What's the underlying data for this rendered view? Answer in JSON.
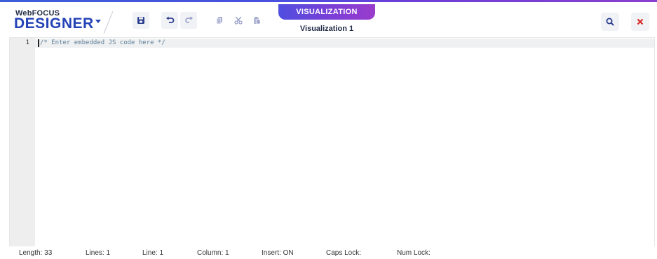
{
  "app": {
    "brand_small": "WebFOCUS",
    "brand_big": "DESIGNER"
  },
  "toolbar": {
    "icons": [
      "save-icon",
      "undo-icon",
      "redo-icon",
      "copy-icon",
      "cut-icon",
      "paste-icon"
    ]
  },
  "tab": {
    "label": "VISUALIZATION",
    "name": "Visualization 1"
  },
  "header_right": {
    "icons": [
      "search-icon",
      "close-icon"
    ]
  },
  "editor": {
    "line_numbers": [
      "1"
    ],
    "code": "/* Enter embedded JS code here */"
  },
  "status": {
    "length": "Length: 33",
    "lines": "Lines: 1",
    "line": "Line: 1",
    "column": "Column: 1",
    "insert": "Insert: ON",
    "caps": "Caps Lock:",
    "num": "Num Lock:"
  },
  "colors": {
    "brand": "#2443b6",
    "accent_gradient_start": "#4f4ee0",
    "accent_gradient_end": "#9a3ccc",
    "close_red": "#d9211e"
  }
}
